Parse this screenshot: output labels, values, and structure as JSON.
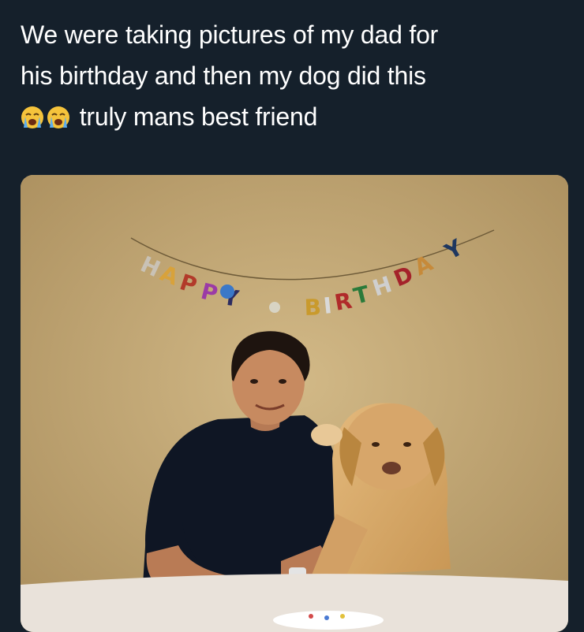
{
  "tweet": {
    "line1": "We were taking pictures of my dad for",
    "line2": "his birthday and then my dog did this",
    "line3": "truly mans best friend",
    "emojis": [
      "loudly-crying-face",
      "loudly-crying-face"
    ]
  },
  "photo": {
    "subject": "man-and-dog-with-birthday-banner",
    "banner_letters": [
      "H",
      "A",
      "P",
      "P",
      "Y",
      "B",
      "I",
      "R",
      "T",
      "H",
      "D",
      "A",
      "Y"
    ]
  },
  "colors": {
    "background": "#15202b",
    "text": "#ffffff",
    "wall": "#c7ad7a"
  }
}
